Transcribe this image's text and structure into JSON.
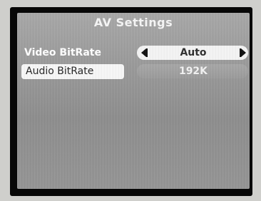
{
  "screen": {
    "title": "AV Settings"
  },
  "settings": [
    {
      "label": "Video BitRate",
      "value": "Auto"
    },
    {
      "label": "Audio BitRate",
      "value": "192K"
    }
  ],
  "colors": {
    "background": "#9a9a9a",
    "text_light": "#ffffff",
    "value_box": "#f4f4f4",
    "value_text_dark": "#2f2f2f",
    "selected_label_bg": "#f7f7f7"
  },
  "icons": {
    "left_arrow": "triangle-left-icon",
    "right_arrow": "triangle-right-icon"
  }
}
